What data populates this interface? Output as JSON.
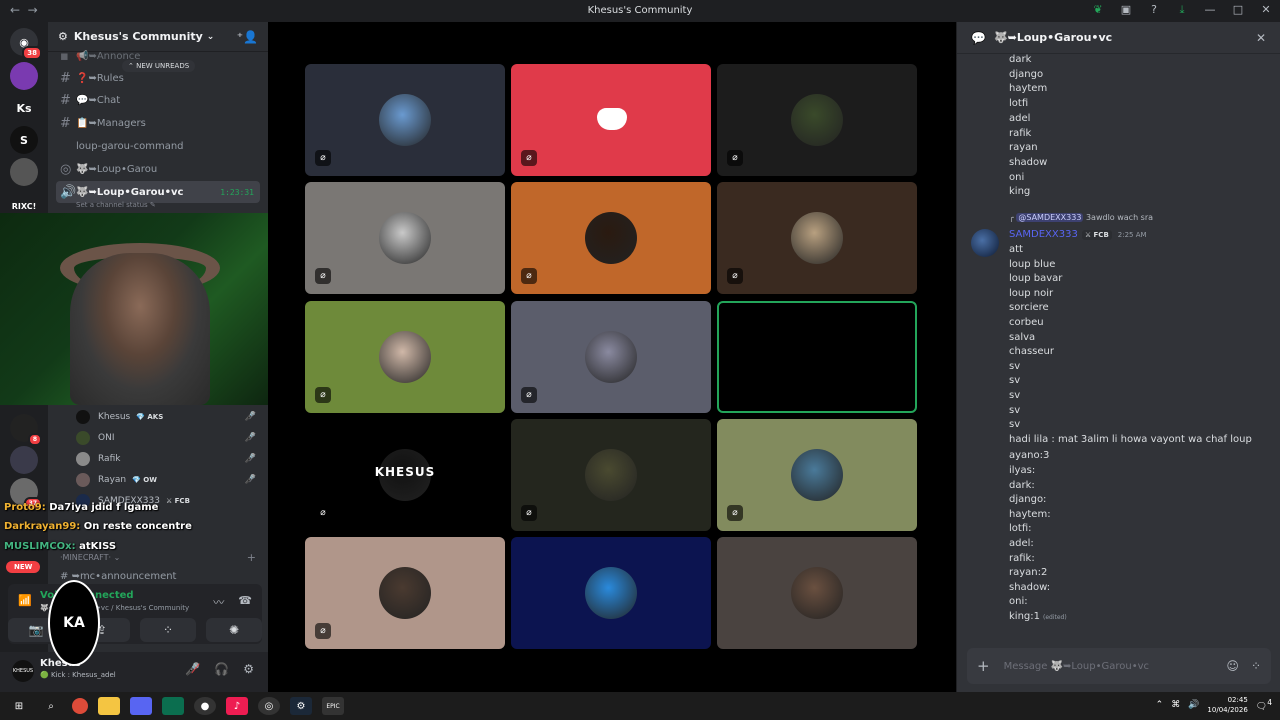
{
  "window": {
    "title": "Khesus's Community"
  },
  "guilds": [
    {
      "icon": "discord-home-icon",
      "badge": "38"
    },
    {
      "icon": "server-icon-1",
      "badge": ""
    },
    {
      "icon": "server-icon-ks",
      "label": "Ks",
      "badge": ""
    },
    {
      "icon": "server-icon-s",
      "label": "S",
      "badge": ""
    },
    {
      "icon": "server-icon-4",
      "badge": ""
    },
    {
      "icon": "server-icon-rixc",
      "label": "RIXC!",
      "badge": ""
    }
  ],
  "sidebar": {
    "server_name": "Khesus's Community",
    "new_unreads": "NEW UNREADS",
    "channels": [
      {
        "name": "📢➥Annonce",
        "icon": "#"
      },
      {
        "name": "❓➥Rules",
        "icon": "#"
      },
      {
        "name": "💬➥Chat",
        "icon": "#"
      },
      {
        "name": "📋➥Managers",
        "icon": "#"
      },
      {
        "name": "loup-garou-command",
        "icon": ""
      },
      {
        "name": "🐺➥Loup•Garou",
        "icon": "◎"
      },
      {
        "name": "🐺➥Loup•Garou•vc",
        "icon": "🔊",
        "timer": "1:23:31"
      }
    ],
    "status_hint": "Set a channel status",
    "voice_users": [
      {
        "name": "Khesus",
        "tag": "💎 AKS"
      },
      {
        "name": "ONI",
        "tag": ""
      },
      {
        "name": "Rafik",
        "tag": ""
      },
      {
        "name": "Rayan",
        "tag": "💎 OW"
      },
      {
        "name": "SAMDEXX333",
        "tag": "⚔ FCB"
      }
    ],
    "category": "MINECRAFT",
    "mc_channel": "➥mc•announcement",
    "new_pill": "NEW"
  },
  "stream_chat": [
    {
      "nick": "Proto9:",
      "text": "Da7iya jdid f lgame",
      "color": "#f0b232"
    },
    {
      "nick": "Darkrayan99:",
      "text": "On reste concentre",
      "color": "#f0b232"
    },
    {
      "nick": "MUSLIMCOx:",
      "text": "atKISS",
      "color": "#43b581"
    }
  ],
  "voice_panel": {
    "status": "Voice Connected",
    "sub": "🐺➥Loup•Garou•vc / Khesus's Community"
  },
  "user_panel": {
    "name": "Khesus",
    "status": "🟢 Kick : Khesus_adel",
    "avatar": "KHESUS"
  },
  "tiles": [
    {
      "bg": "#2a2e3a",
      "avatar": "#6a9ad0",
      "label": ""
    },
    {
      "bg": "#e03a4a",
      "avatar": "",
      "label": "",
      "discord": true
    },
    {
      "bg": "#1c1c1c",
      "avatar": "#3a4a2a",
      "label": ""
    },
    {
      "bg": "#7a7774",
      "avatar": "#c9c9c9",
      "label": ""
    },
    {
      "bg": "#c0672a",
      "avatar": "#2a1a10",
      "label": ""
    },
    {
      "bg": "#3a2a20",
      "avatar": "#b8a080",
      "label": ""
    },
    {
      "bg": "#6e8a3a",
      "avatar": "#d0b8a8",
      "label": ""
    },
    {
      "bg": "#5b5d6b",
      "avatar": "#8a8aa0",
      "label": ""
    },
    {
      "bg": "#000000",
      "avatar": "",
      "label": "",
      "speaking": true
    },
    {
      "bg": "#000000",
      "avatar": "#111",
      "label": "KHESUS"
    },
    {
      "bg": "#24261e",
      "avatar": "#4a4a30",
      "label": ""
    },
    {
      "bg": "#828b5e",
      "avatar": "#4a7a9a",
      "label": ""
    },
    {
      "bg": "#b0968a",
      "avatar": "#4a3a30",
      "label": ""
    },
    {
      "bg": "#0c1450",
      "avatar": "#2a8adc",
      "label": ""
    },
    {
      "bg": "#4a4340",
      "avatar": "#6a5040",
      "label": ""
    }
  ],
  "chat": {
    "title": "🐺➥Loup•Garou•vc",
    "top_lines": [
      "dark",
      "django",
      "haytem",
      "lotfi",
      "adel",
      "rafik",
      "rayan",
      "shadow",
      "oni",
      "king"
    ],
    "reply_to": "@SAMDEXX333",
    "reply_text": "3awdlo wach sra",
    "author": "SAMDEXX333",
    "author_tag": "⚔ FCB",
    "time": "2:25 AM",
    "lines": [
      "att",
      "loup blue",
      "loup bavar",
      "loup noir",
      "sorciere",
      "corbeu",
      "salva",
      "chasseur",
      "sv",
      "sv",
      "sv",
      "sv",
      "sv",
      "hadi lila : mat 3alim li howa vayont wa chaf loup",
      "ayano:3",
      "ilyas:",
      "dark:",
      "django:",
      "haytem:",
      "lotfi:",
      "adel:",
      "rafik:",
      "rayan:2",
      "shadow:",
      "oni:",
      "king:1"
    ],
    "edited": "(edited)",
    "composer_placeholder": "Message 🐺➥Loup•Garou•vc"
  },
  "taskbar": {
    "time": "02:45",
    "date": "10/04/2026",
    "notif": "4"
  }
}
